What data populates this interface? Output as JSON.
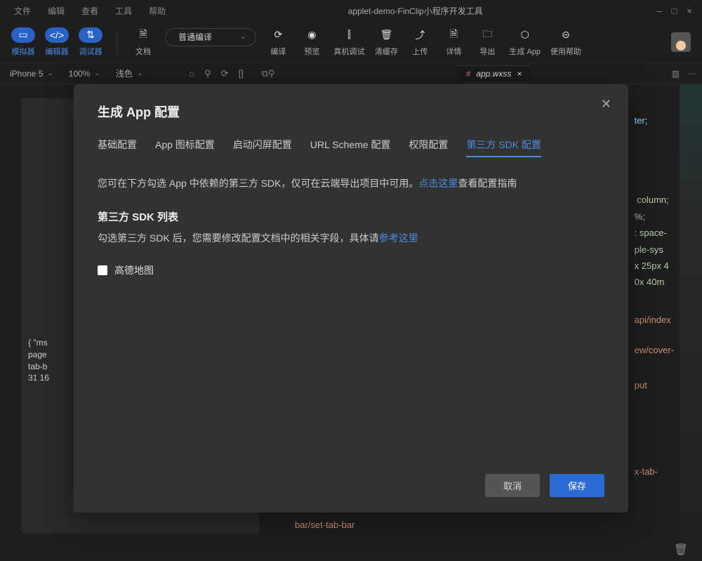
{
  "menubar": {
    "items": [
      "文件",
      "编辑",
      "查看",
      "工具",
      "帮助"
    ],
    "title": "applet-demo-FinClip小程序开发工具",
    "window_controls": [
      "–",
      "□",
      "×"
    ]
  },
  "toolbar": {
    "items": [
      {
        "label": "模拟器",
        "icon": "▭",
        "blue": true
      },
      {
        "label": "编辑器",
        "icon": "</>",
        "blue": true
      },
      {
        "label": "调试器",
        "icon": "⇅",
        "blue": true
      },
      {
        "label": "文档",
        "icon": "🗎",
        "blue": false
      }
    ],
    "compile_select": "普通编译",
    "right_items": [
      {
        "label": "编译",
        "icon": "⟳"
      },
      {
        "label": "预览",
        "icon": "◉"
      },
      {
        "label": "真机调试",
        "icon": "⫿"
      },
      {
        "label": "清缓存",
        "icon": "🗑"
      },
      {
        "label": "上传",
        "icon": "⤴"
      },
      {
        "label": "详情",
        "icon": "🗎"
      },
      {
        "label": "导出",
        "icon": "🗀"
      },
      {
        "label": "生成 App",
        "icon": "⬡"
      },
      {
        "label": "使用帮助",
        "icon": "⊝"
      }
    ]
  },
  "subtool": {
    "device": "iPhone 5",
    "zoom": "100%",
    "theme": "浅色",
    "mid_icons": [
      "⌂",
      "⚲",
      "⟳",
      "[]"
    ],
    "split_icons": [
      "⧉",
      "⚲"
    ],
    "file_tab": {
      "icon": "#",
      "name": "app.wxss",
      "close": "×"
    },
    "right_icons": [
      "▥",
      "⋯"
    ]
  },
  "preview": {
    "log": "{ \"ms\npage\ntab-b\n31 16"
  },
  "code": {
    "lines": [
      "ter;",
      "",
      " column;",
      "%;",
      ": space-",
      "",
      "ple-sys",
      "",
      "x 25px 4",
      "0x 40m"
    ],
    "links": [
      "api/index",
      "ew/cover-",
      "put",
      "",
      "x-tab-"
    ],
    "bottom": "bar/set-tab-bar"
  },
  "modal": {
    "title": "生成 App 配置",
    "tabs": [
      "基础配置",
      "App 图标配置",
      "启动闪屏配置",
      "URL Scheme 配置",
      "权限配置",
      "第三方 SDK 配置"
    ],
    "active_tab": 5,
    "desc_pre": "您可在下方勾选 App 中依赖的第三方 SDK，仅可在云端导出项目中可用。",
    "desc_link": "点击这里",
    "desc_post": "查看配置指南",
    "section_title": "第三方 SDK 列表",
    "section_sub_pre": "勾选第三方 SDK 后，您需要修改配置文档中的相关字段，具体请",
    "section_sub_link": "参考这里",
    "checkbox_label": "高德地图",
    "cancel": "取消",
    "save": "保存"
  }
}
